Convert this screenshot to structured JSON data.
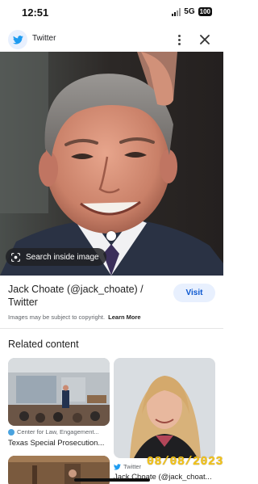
{
  "status_bar": {
    "time": "12:51",
    "network": "5G",
    "battery": "100"
  },
  "top_bar": {
    "site_name": "Twitter",
    "logo_icon": "twitter-bird-icon"
  },
  "hero": {
    "lens_chip_label": "Search inside image"
  },
  "result": {
    "title": "Jack Choate (@jack_choate) / Twitter",
    "visit_label": "Visit",
    "copyright_notice": "Images may be subject to copyright.",
    "learn_more": "Learn More"
  },
  "related": {
    "heading": "Related content",
    "cards": [
      {
        "source": "Center for Law, Engagement...",
        "title": "Texas Special Prosecution..."
      },
      {
        "source": "Twitter",
        "title": "Jack Choate (@jack_choat..."
      },
      {
        "source": "",
        "title": ""
      }
    ]
  },
  "date_stamp": "08/08/2023",
  "colors": {
    "accent": "#0b57d0",
    "visit_bg": "#e8f0fe",
    "twitter_blue": "#1d9bf0",
    "date_stamp": "#f5c518"
  }
}
